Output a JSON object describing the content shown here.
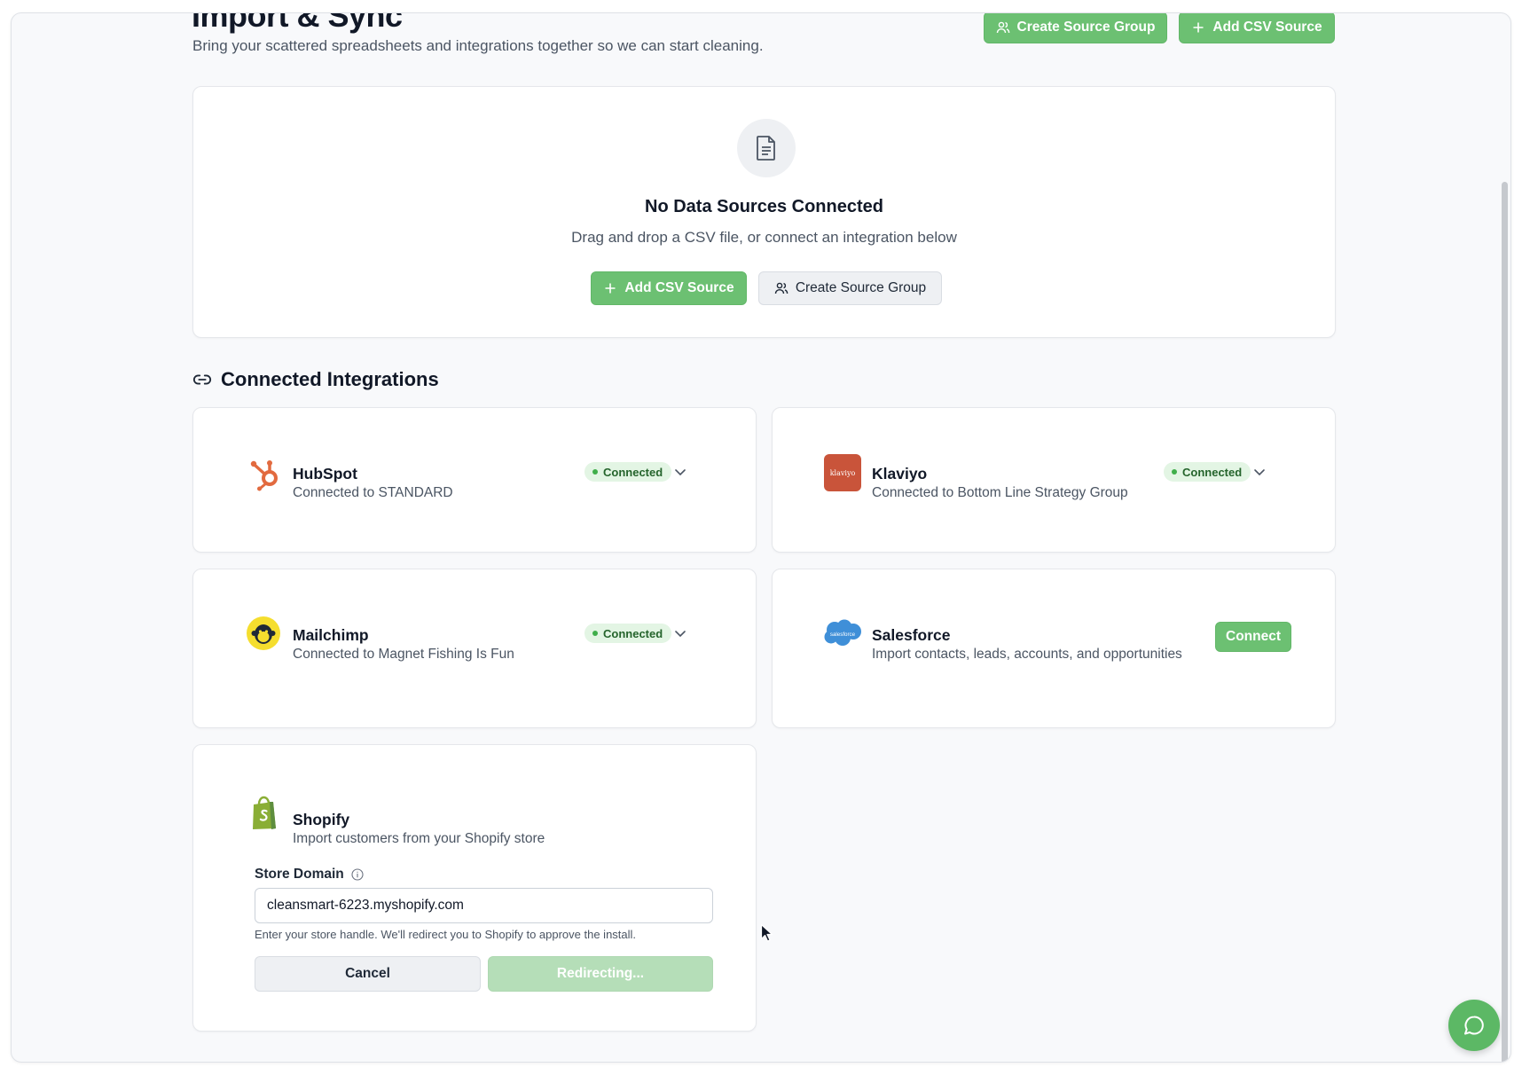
{
  "header": {
    "title": "Import & Sync",
    "subtitle": "Bring your scattered spreadsheets and integrations together so we can start cleaning.",
    "create_group_label": "Create Source Group",
    "add_csv_label": "Add CSV Source"
  },
  "empty_state": {
    "title": "No Data Sources Connected",
    "description": "Drag and drop a CSV file, or connect an integration below",
    "add_csv_label": "Add CSV Source",
    "create_group_label": "Create Source Group"
  },
  "integrations": {
    "section_title": "Connected Integrations",
    "hubspot": {
      "name": "HubSpot",
      "desc": "Connected to STANDARD",
      "status": "Connected"
    },
    "klaviyo": {
      "name": "Klaviyo",
      "desc": "Connected to Bottom Line Strategy Group",
      "status": "Connected",
      "logo_text": "klaviyo"
    },
    "mailchimp": {
      "name": "Mailchimp",
      "desc": "Connected to Magnet Fishing Is Fun",
      "status": "Connected"
    },
    "salesforce": {
      "name": "Salesforce",
      "desc": "Import contacts, leads, accounts, and opportunities",
      "connect_label": "Connect",
      "logo_text": "salesforce"
    },
    "shopify": {
      "name": "Shopify",
      "desc": "Import customers from your Shopify store",
      "field_label": "Store Domain",
      "field_value": "cleansmart-6223.myshopify.com",
      "help": "Enter your store handle. We'll redirect you to Shopify to approve the install.",
      "cancel_label": "Cancel",
      "submit_label": "Redirecting..."
    }
  },
  "colors": {
    "accent": "#6cc072",
    "hubspot": "#e26a3f",
    "klaviyo": "#c9543a",
    "salesforce": "#3f8fd8",
    "shopify": "#8aae35",
    "mailchimp": "#f5de2e"
  },
  "icons": {
    "header_group": "users-icon",
    "header_add": "plus-icon",
    "empty": "document-icon",
    "section": "link-icon",
    "expand": "chevron-down-icon",
    "info": "info-icon",
    "chat": "chat-bubble-icon"
  }
}
